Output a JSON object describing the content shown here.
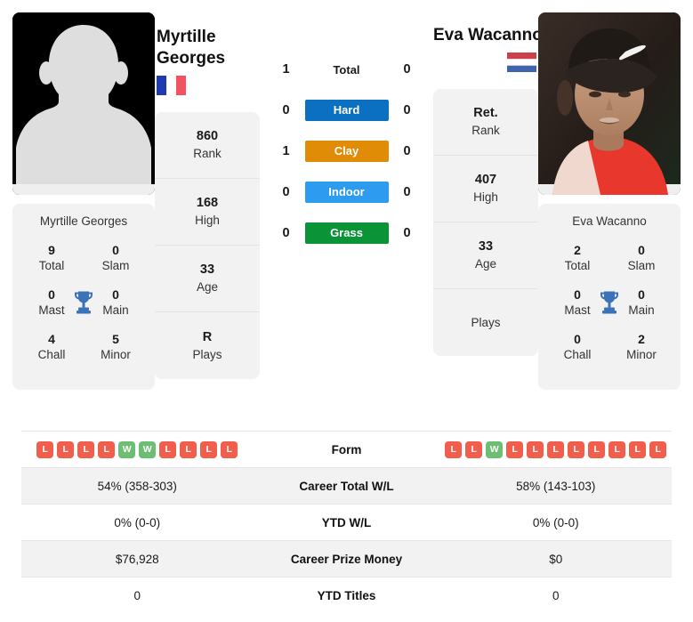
{
  "players": {
    "left": {
      "name_line1": "Myrtille",
      "name_line2": "Georges",
      "full_name": "Myrtille Georges",
      "country": "France",
      "flag_icon": "flag-france",
      "photo_type": "placeholder-avatar",
      "ranks": [
        {
          "value": "860",
          "label": "Rank"
        },
        {
          "value": "168",
          "label": "High"
        },
        {
          "value": "33",
          "label": "Age"
        },
        {
          "value": "R",
          "label": "Plays"
        }
      ],
      "titles": [
        {
          "value": "9",
          "label": "Total"
        },
        {
          "value": "0",
          "label": "Slam"
        },
        {
          "value": "0",
          "label": "Mast"
        },
        {
          "value": "0",
          "label": "Main"
        },
        {
          "value": "4",
          "label": "Chall"
        },
        {
          "value": "5",
          "label": "Minor"
        }
      ],
      "form": [
        "L",
        "L",
        "L",
        "L",
        "W",
        "W",
        "L",
        "L",
        "L",
        "L"
      ]
    },
    "right": {
      "name_line1": "Eva Wacanno",
      "name_line2": "",
      "full_name": "Eva Wacanno",
      "country": "Netherlands",
      "flag_icon": "flag-netherlands",
      "photo_type": "player-photo",
      "ranks": [
        {
          "value": "Ret.",
          "label": "Rank"
        },
        {
          "value": "407",
          "label": "High"
        },
        {
          "value": "33",
          "label": "Age"
        },
        {
          "value": "",
          "label": "Plays"
        }
      ],
      "titles": [
        {
          "value": "2",
          "label": "Total"
        },
        {
          "value": "0",
          "label": "Slam"
        },
        {
          "value": "0",
          "label": "Mast"
        },
        {
          "value": "0",
          "label": "Main"
        },
        {
          "value": "0",
          "label": "Chall"
        },
        {
          "value": "2",
          "label": "Minor"
        }
      ],
      "form": [
        "L",
        "L",
        "W",
        "L",
        "L",
        "L",
        "L",
        "L",
        "L",
        "L",
        "L"
      ]
    }
  },
  "h2h": {
    "rows": [
      {
        "label": "Total",
        "left": "1",
        "right": "0",
        "badge": false,
        "color": ""
      },
      {
        "label": "Hard",
        "left": "0",
        "right": "0",
        "badge": true,
        "color": "#0b6fc2"
      },
      {
        "label": "Clay",
        "left": "1",
        "right": "0",
        "badge": true,
        "color": "#e08c06"
      },
      {
        "label": "Indoor",
        "left": "0",
        "right": "0",
        "badge": true,
        "color": "#2d9bf0"
      },
      {
        "label": "Grass",
        "left": "0",
        "right": "0",
        "badge": true,
        "color": "#0b9437"
      }
    ]
  },
  "table": {
    "form_label": "Form",
    "rows": [
      {
        "label": "Career Total W/L",
        "left": "54% (358-303)",
        "right": "58% (143-103)"
      },
      {
        "label": "YTD W/L",
        "left": "0% (0-0)",
        "right": "0% (0-0)"
      },
      {
        "label": "Career Prize Money",
        "left": "$76,928",
        "right": "$0"
      },
      {
        "label": "YTD Titles",
        "left": "0",
        "right": "0"
      }
    ]
  },
  "colors": {
    "win_badge": "#6cbf72",
    "loss_badge": "#f15f4c",
    "trophy": "#3b72b8",
    "card_bg": "#f2f2f2"
  }
}
